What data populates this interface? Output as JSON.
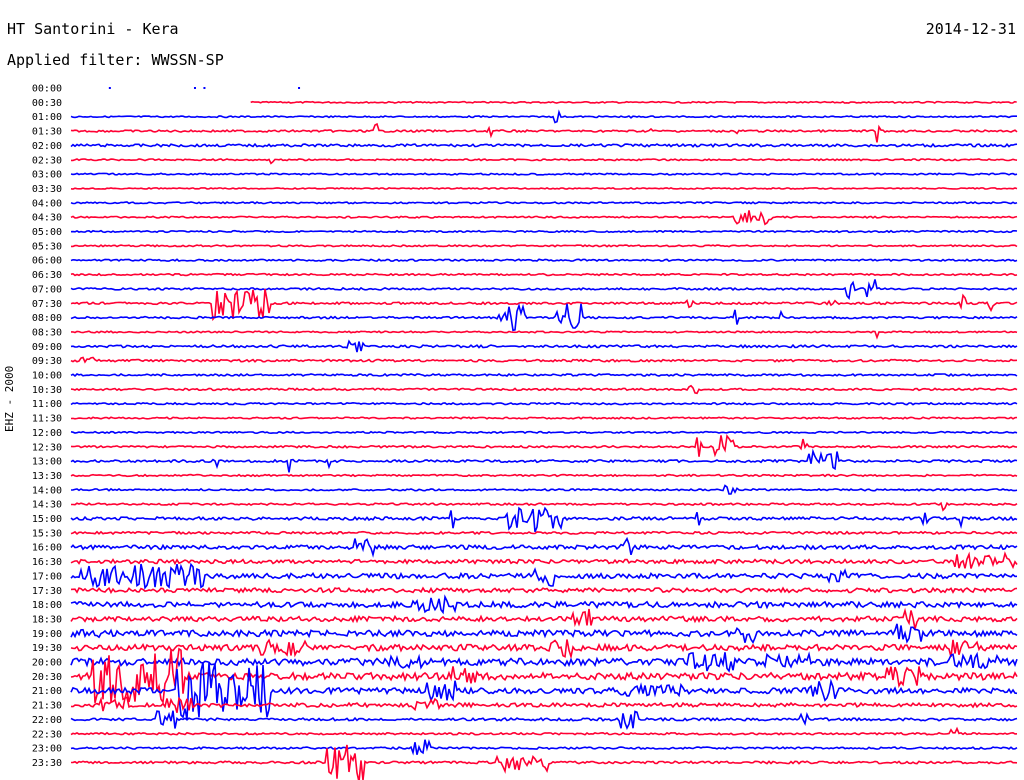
{
  "header": {
    "station": "HT Santorini - Kera",
    "filter": "Applied filter: WWSSN-SP",
    "date": "2014-12-31"
  },
  "chart_data": {
    "type": "line",
    "title": "HT Santorini - Kera",
    "subtitle": "Applied filter: WWSSN-SP",
    "ylabel": "EHZ - 2000",
    "date": "2014-12-31",
    "colors": {
      "even": "#0000ff",
      "odd": "#ff0033"
    },
    "rows": [
      {
        "label": "00:00",
        "start": 0.0,
        "end": 0.26,
        "noise": 0.0,
        "bursts": []
      },
      {
        "label": "00:30",
        "start": 0.19,
        "end": 1.0,
        "noise": 0.7,
        "bursts": []
      },
      {
        "label": "01:00",
        "start": 0.0,
        "end": 1.0,
        "noise": 0.7,
        "bursts": [
          [
            0.51,
            0.7,
            6
          ],
          [
            0.59,
            0.4,
            5
          ]
        ]
      },
      {
        "label": "01:30",
        "start": 0.0,
        "end": 1.0,
        "noise": 1.0,
        "bursts": [
          [
            0.32,
            0.5,
            10
          ],
          [
            0.44,
            0.5,
            12
          ],
          [
            0.61,
            0.5,
            8
          ],
          [
            0.7,
            0.6,
            12
          ],
          [
            0.85,
            0.6,
            12
          ]
        ]
      },
      {
        "label": "02:00",
        "start": 0.0,
        "end": 1.0,
        "noise": 1.3,
        "bursts": []
      },
      {
        "label": "02:30",
        "start": 0.0,
        "end": 1.0,
        "noise": 0.8,
        "bursts": [
          [
            0.21,
            0.3,
            4
          ]
        ]
      },
      {
        "label": "03:00",
        "start": 0.0,
        "end": 1.0,
        "noise": 0.8,
        "bursts": []
      },
      {
        "label": "03:30",
        "start": 0.0,
        "end": 1.0,
        "noise": 0.6,
        "bursts": []
      },
      {
        "label": "04:00",
        "start": 0.0,
        "end": 1.0,
        "noise": 0.8,
        "bursts": []
      },
      {
        "label": "04:30",
        "start": 0.0,
        "end": 1.0,
        "noise": 0.8,
        "bursts": [
          [
            0.7,
            4.0,
            8
          ]
        ]
      },
      {
        "label": "05:00",
        "start": 0.0,
        "end": 1.0,
        "noise": 0.8,
        "bursts": []
      },
      {
        "label": "05:30",
        "start": 0.0,
        "end": 1.0,
        "noise": 0.8,
        "bursts": []
      },
      {
        "label": "06:00",
        "start": 0.0,
        "end": 1.0,
        "noise": 0.9,
        "bursts": []
      },
      {
        "label": "06:30",
        "start": 0.0,
        "end": 1.0,
        "noise": 0.9,
        "bursts": []
      },
      {
        "label": "07:00",
        "start": 0.0,
        "end": 1.0,
        "noise": 1.0,
        "bursts": [
          [
            0.82,
            1.0,
            12
          ],
          [
            0.84,
            1.0,
            10
          ]
        ]
      },
      {
        "label": "07:30",
        "start": 0.0,
        "end": 1.0,
        "noise": 1.1,
        "bursts": [
          [
            0.15,
            6.0,
            16
          ],
          [
            0.65,
            0.8,
            4
          ],
          [
            0.8,
            1.0,
            4
          ],
          [
            0.94,
            0.6,
            8
          ],
          [
            0.97,
            0.6,
            8
          ]
        ]
      },
      {
        "label": "08:00",
        "start": 0.0,
        "end": 1.0,
        "noise": 1.0,
        "bursts": [
          [
            0.45,
            3.0,
            14
          ],
          [
            0.51,
            3.0,
            14
          ],
          [
            0.7,
            0.6,
            10
          ],
          [
            0.75,
            0.3,
            6
          ]
        ]
      },
      {
        "label": "08:30",
        "start": 0.0,
        "end": 1.0,
        "noise": 0.8,
        "bursts": [
          [
            0.85,
            0.3,
            10
          ]
        ]
      },
      {
        "label": "09:00",
        "start": 0.0,
        "end": 1.0,
        "noise": 1.2,
        "bursts": [
          [
            0.29,
            2.0,
            6
          ]
        ]
      },
      {
        "label": "09:30",
        "start": 0.0,
        "end": 1.0,
        "noise": 1.1,
        "bursts": [
          [
            0.01,
            1.5,
            4
          ]
        ]
      },
      {
        "label": "10:00",
        "start": 0.0,
        "end": 1.0,
        "noise": 1.0,
        "bursts": []
      },
      {
        "label": "10:30",
        "start": 0.0,
        "end": 1.0,
        "noise": 1.0,
        "bursts": [
          [
            0.65,
            1.5,
            4
          ]
        ]
      },
      {
        "label": "11:00",
        "start": 0.0,
        "end": 1.0,
        "noise": 0.9,
        "bursts": []
      },
      {
        "label": "11:30",
        "start": 0.0,
        "end": 1.0,
        "noise": 0.8,
        "bursts": []
      },
      {
        "label": "12:00",
        "start": 0.0,
        "end": 1.0,
        "noise": 0.8,
        "bursts": []
      },
      {
        "label": "12:30",
        "start": 0.0,
        "end": 1.0,
        "noise": 1.0,
        "bursts": [
          [
            0.66,
            0.6,
            10
          ],
          [
            0.68,
            2.0,
            14
          ],
          [
            0.77,
            1.0,
            12
          ]
        ]
      },
      {
        "label": "13:00",
        "start": 0.0,
        "end": 1.0,
        "noise": 1.2,
        "bursts": [
          [
            0.15,
            0.6,
            12
          ],
          [
            0.23,
            0.6,
            12
          ],
          [
            0.27,
            0.3,
            6
          ],
          [
            0.78,
            3.0,
            10
          ]
        ]
      },
      {
        "label": "13:30",
        "start": 0.0,
        "end": 1.0,
        "noise": 0.9,
        "bursts": []
      },
      {
        "label": "14:00",
        "start": 0.0,
        "end": 1.0,
        "noise": 0.9,
        "bursts": [
          [
            0.69,
            1.5,
            5
          ]
        ]
      },
      {
        "label": "14:30",
        "start": 0.0,
        "end": 1.0,
        "noise": 1.0,
        "bursts": [
          [
            0.92,
            0.3,
            6
          ]
        ]
      },
      {
        "label": "15:00",
        "start": 0.0,
        "end": 1.0,
        "noise": 1.5,
        "bursts": [
          [
            0.46,
            6.0,
            14
          ],
          [
            0.4,
            0.5,
            12
          ],
          [
            0.66,
            0.4,
            8
          ],
          [
            0.9,
            0.5,
            10
          ],
          [
            0.94,
            0.5,
            8
          ]
        ]
      },
      {
        "label": "15:30",
        "start": 0.0,
        "end": 1.0,
        "noise": 1.2,
        "bursts": []
      },
      {
        "label": "16:00",
        "start": 0.0,
        "end": 1.0,
        "noise": 2.0,
        "bursts": [
          [
            0.3,
            2.0,
            10
          ],
          [
            0.58,
            1.2,
            10
          ]
        ]
      },
      {
        "label": "16:30",
        "start": 0.0,
        "end": 1.0,
        "noise": 2.0,
        "bursts": [
          [
            0.93,
            6.0,
            8
          ],
          [
            0.97,
            6.0,
            6
          ]
        ]
      },
      {
        "label": "17:00",
        "start": 0.0,
        "end": 1.0,
        "noise": 2.5,
        "bursts": [
          [
            0.01,
            8.0,
            12
          ],
          [
            0.06,
            8.0,
            12
          ],
          [
            0.49,
            2.0,
            10
          ],
          [
            0.8,
            2.0,
            10
          ]
        ]
      },
      {
        "label": "17:30",
        "start": 0.0,
        "end": 1.0,
        "noise": 2.2,
        "bursts": []
      },
      {
        "label": "18:00",
        "start": 0.0,
        "end": 1.0,
        "noise": 2.8,
        "bursts": [
          [
            0.36,
            5.0,
            8
          ]
        ]
      },
      {
        "label": "18:30",
        "start": 0.0,
        "end": 1.0,
        "noise": 2.5,
        "bursts": [
          [
            0.53,
            2.0,
            10
          ],
          [
            0.88,
            2.0,
            10
          ]
        ]
      },
      {
        "label": "19:00",
        "start": 0.0,
        "end": 1.0,
        "noise": 3.0,
        "bursts": [
          [
            0.0,
            3.0,
            4
          ],
          [
            0.7,
            2.5,
            10
          ],
          [
            0.87,
            3.0,
            10
          ]
        ]
      },
      {
        "label": "19:30",
        "start": 0.0,
        "end": 1.0,
        "noise": 3.0,
        "bursts": [
          [
            0.2,
            5.0,
            8
          ],
          [
            0.5,
            3.0,
            10
          ],
          [
            0.93,
            3.0,
            10
          ]
        ]
      },
      {
        "label": "20:00",
        "start": 0.0,
        "end": 1.0,
        "noise": 3.5,
        "bursts": [
          [
            0.33,
            4.0,
            6
          ],
          [
            0.65,
            5.0,
            10
          ],
          [
            0.73,
            6.0,
            8
          ],
          [
            0.93,
            5.0,
            8
          ]
        ]
      },
      {
        "label": "20:30",
        "start": 0.0,
        "end": 1.0,
        "noise": 3.5,
        "bursts": [
          [
            0.02,
            10.0,
            28
          ],
          [
            0.4,
            3.0,
            10
          ],
          [
            0.86,
            4.0,
            10
          ]
        ]
      },
      {
        "label": "21:00",
        "start": 0.0,
        "end": 1.0,
        "noise": 2.8,
        "bursts": [
          [
            0.11,
            10.0,
            30
          ],
          [
            0.37,
            4.0,
            10
          ],
          [
            0.58,
            8.0,
            6
          ],
          [
            0.78,
            3.0,
            10
          ]
        ]
      },
      {
        "label": "21:30",
        "start": 0.0,
        "end": 1.0,
        "noise": 2.0,
        "bursts": [
          [
            0.03,
            3.0,
            8
          ],
          [
            0.1,
            3.0,
            8
          ],
          [
            0.36,
            3.0,
            6
          ]
        ]
      },
      {
        "label": "22:00",
        "start": 0.0,
        "end": 1.0,
        "noise": 1.3,
        "bursts": [
          [
            0.09,
            2.0,
            10
          ],
          [
            0.58,
            2.0,
            10
          ],
          [
            0.77,
            1.0,
            8
          ]
        ]
      },
      {
        "label": "22:30",
        "start": 0.0,
        "end": 1.0,
        "noise": 1.0,
        "bursts": [
          [
            0.93,
            1.0,
            6
          ]
        ]
      },
      {
        "label": "23:00",
        "start": 0.0,
        "end": 1.0,
        "noise": 1.0,
        "bursts": [
          [
            0.36,
            2.0,
            10
          ]
        ]
      },
      {
        "label": "23:30",
        "start": 0.0,
        "end": 1.0,
        "noise": 1.2,
        "bursts": [
          [
            0.27,
            4.0,
            20
          ],
          [
            0.45,
            6.0,
            10
          ]
        ]
      }
    ]
  }
}
